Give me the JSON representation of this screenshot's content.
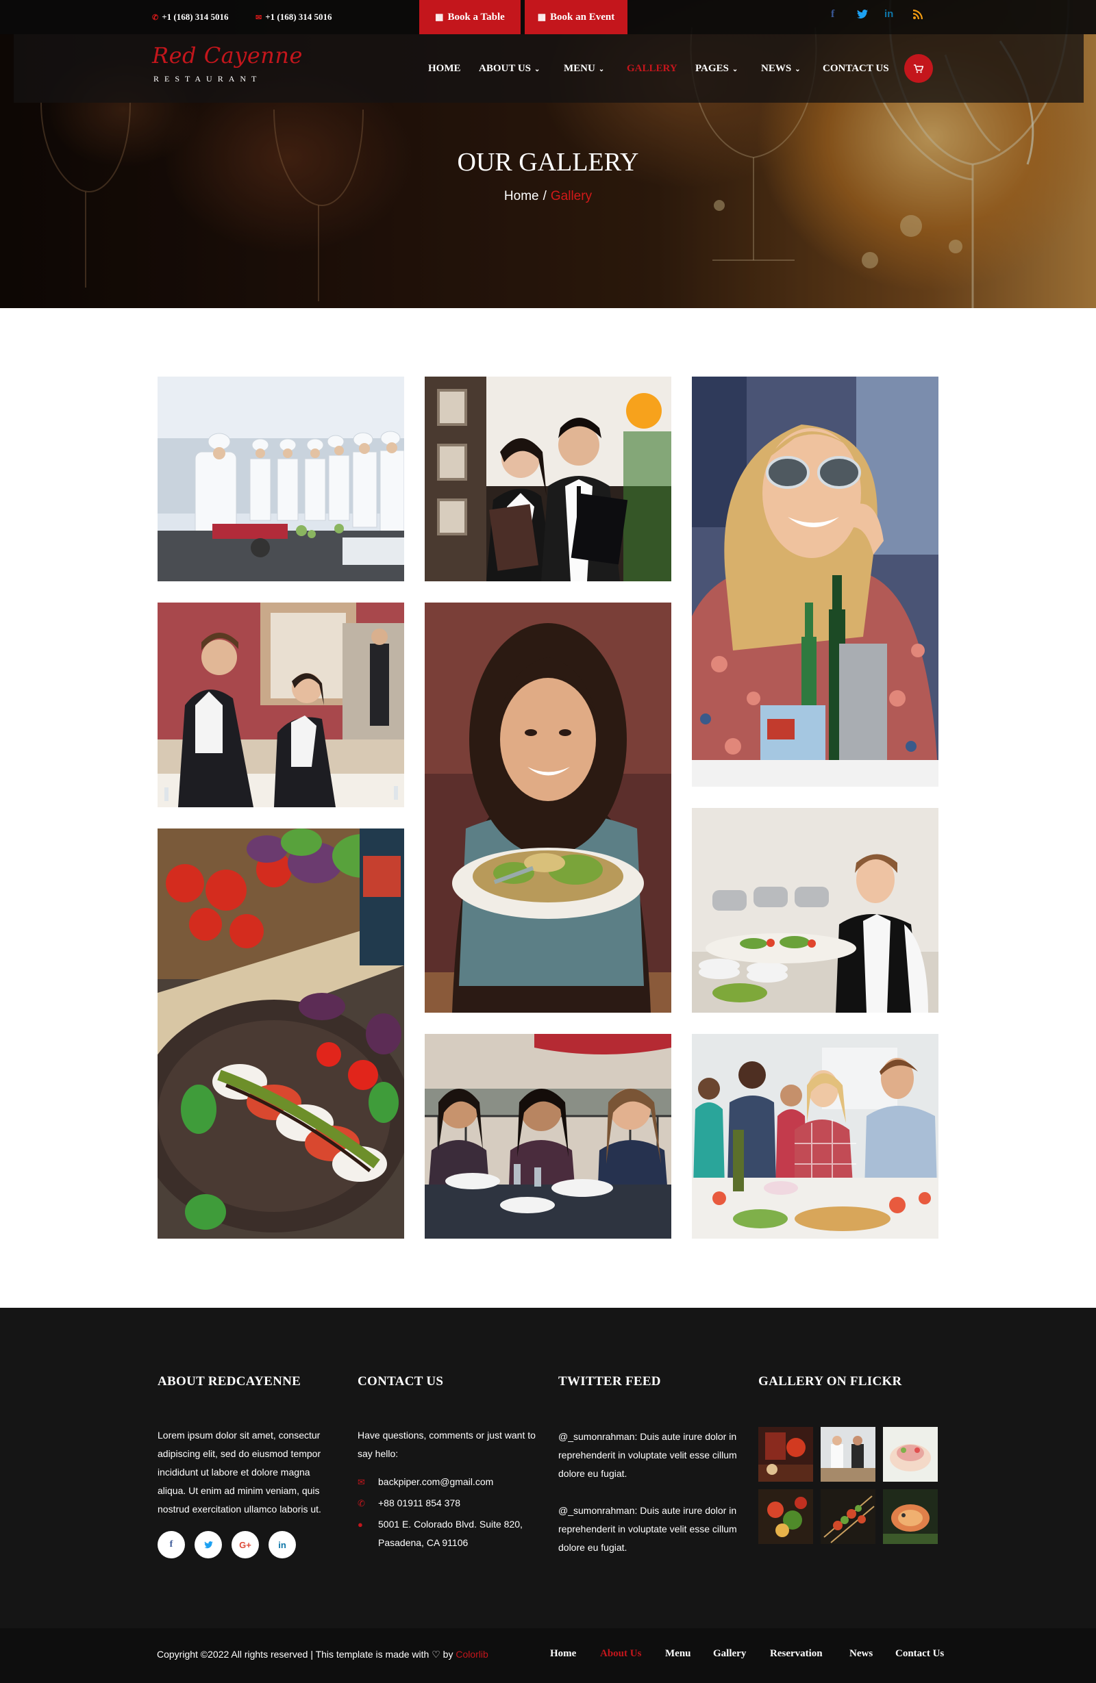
{
  "topbar": {
    "phone1": "+1 (168) 314 5016",
    "phone2": "+1 (168) 314 5016",
    "phone_icon": "phone-icon",
    "mail_icon": "envelope-icon",
    "book_table": "Book a Table",
    "book_event": "Book an Event",
    "book_icon": "calendar-icon",
    "social": [
      {
        "name": "facebook-icon",
        "glyph": "f",
        "color": "#3b5998"
      },
      {
        "name": "twitter-icon",
        "glyph": "t",
        "color": "#1da1f2"
      },
      {
        "name": "linkedin-icon",
        "glyph": "in",
        "color": "#0e76a8"
      },
      {
        "name": "rss-icon",
        "glyph": "◤",
        "color": "#f39c12"
      }
    ]
  },
  "logo": {
    "script": "Red Cayenne",
    "sub": "RESTAURANT"
  },
  "nav": {
    "items": [
      {
        "label": "HOME",
        "dropdown": false,
        "active": false
      },
      {
        "label": "ABOUT US",
        "dropdown": true,
        "active": false
      },
      {
        "label": "MENU",
        "dropdown": true,
        "active": false
      },
      {
        "label": "GALLERY",
        "dropdown": false,
        "active": true
      },
      {
        "label": "PAGES",
        "dropdown": true,
        "active": false
      },
      {
        "label": "NEWS",
        "dropdown": true,
        "active": false
      },
      {
        "label": "CONTACT US",
        "dropdown": false,
        "active": false
      }
    ],
    "cart_icon": "cart-icon"
  },
  "hero": {
    "title": "OUR GALLERY",
    "breadcrumb_home": "Home",
    "breadcrumb_sep": "/",
    "breadcrumb_current": "Gallery"
  },
  "gallery": {
    "images": [
      {
        "name": "gallery-image-chefs-class",
        "alt": "chefs cooking class"
      },
      {
        "name": "gallery-image-waiters-menus",
        "alt": "waiters holding menus"
      },
      {
        "name": "gallery-image-woman-sunglasses",
        "alt": "woman in sunglasses"
      },
      {
        "name": "gallery-image-waiters-setting",
        "alt": "waiters setting tables"
      },
      {
        "name": "gallery-image-woman-plate",
        "alt": "woman holding plate"
      },
      {
        "name": "gallery-image-caprese",
        "alt": "caprese salad"
      },
      {
        "name": "gallery-image-waitress-buffet",
        "alt": "waitress with buffet platter"
      },
      {
        "name": "gallery-image-friends-dining",
        "alt": "friends dining outdoors"
      },
      {
        "name": "gallery-image-friends-cooking",
        "alt": "friends cooking party"
      }
    ]
  },
  "footer": {
    "about": {
      "heading": "ABOUT REDCAYENNE",
      "text": "Lorem ipsum dolor sit amet, consectur adipiscing elit, sed do eiusmod tempor incididunt ut labore et dolore magna aliqua. Ut enim ad minim veniam, quis nostrud exercitation ullamco laboris ut."
    },
    "social": [
      {
        "name": "facebook-icon",
        "glyph": "f",
        "color": "#3b5998"
      },
      {
        "name": "twitter-icon",
        "glyph": "t",
        "color": "#1da1f2"
      },
      {
        "name": "google-plus-icon",
        "glyph": "G+",
        "color": "#dd4b39"
      },
      {
        "name": "linkedin-icon",
        "glyph": "in",
        "color": "#0e76a8"
      }
    ],
    "contact": {
      "heading": "CONTACT US",
      "intro": "Have questions, comments or just want to say hello:",
      "email": "backpiper.com@gmail.com",
      "phone": "+88 01911 854 378",
      "address_line1": "5001 E. Colorado Blvd. Suite 820,",
      "address_line2": "Pasadena, CA 91106"
    },
    "twitter": {
      "heading": "TWITTER FEED",
      "tweets": [
        "@_sumonrahman: Duis aute irure dolor in reprehenderit in voluptate velit esse cillum dolore eu fugiat.",
        "@_sumonrahman: Duis aute irure dolor in reprehenderit in voluptate velit esse cillum dolore eu fugiat."
      ]
    },
    "flickr": {
      "heading": "GALLERY ON FLICKR"
    },
    "copyright": "Copyright ©2022 All rights reserved | This template is made with",
    "by": "by",
    "brand": "Colorlib",
    "heart_icon": "heart-icon",
    "bottom_nav": [
      "Home",
      "About Us",
      "Menu",
      "Gallery",
      "Reservation",
      "News",
      "Contact Us"
    ],
    "bottom_nav_active": "About Us"
  }
}
